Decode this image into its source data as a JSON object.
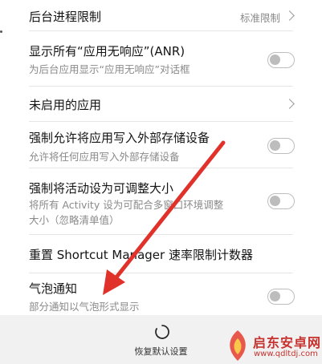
{
  "settings": [
    {
      "title": "后台进程限制",
      "value": "标准限制",
      "control": "chevron"
    },
    {
      "title": "显示所有“应用无响应”(ANR)",
      "subtitle": "为后台应用显示“应用无响应”对话框",
      "control": "toggle",
      "checked": false
    },
    {
      "title": "未启用的应用",
      "control": "chevron"
    },
    {
      "title": "强制允许将应用写入外部存储设备",
      "subtitle": "允许将任何应用写入外部存储设备",
      "control": "toggle",
      "checked": false
    },
    {
      "title": "强制将活动设为可调整大小",
      "subtitle_line1": "将所有 Activity 设为可配合多窗口环境调整",
      "subtitle_line2": "大小（忽略清单值）",
      "control": "toggle",
      "checked": false
    },
    {
      "title": "重置 Shortcut Manager 速率限制计数器"
    },
    {
      "title": "气泡通知",
      "subtitle": "部分通知以气泡形式显示",
      "control": "toggle",
      "checked": false
    }
  ],
  "bottom_bar": {
    "restore_label": "恢复默认设置",
    "restore_icon": "refresh-icon"
  },
  "watermark": {
    "brand": "启东安卓网",
    "url": "www.qdltdj.com"
  },
  "colors": {
    "annotation_arrow": "#e0312a",
    "toggle_off": "#bdbdbd",
    "watermark": "#c7312e"
  }
}
